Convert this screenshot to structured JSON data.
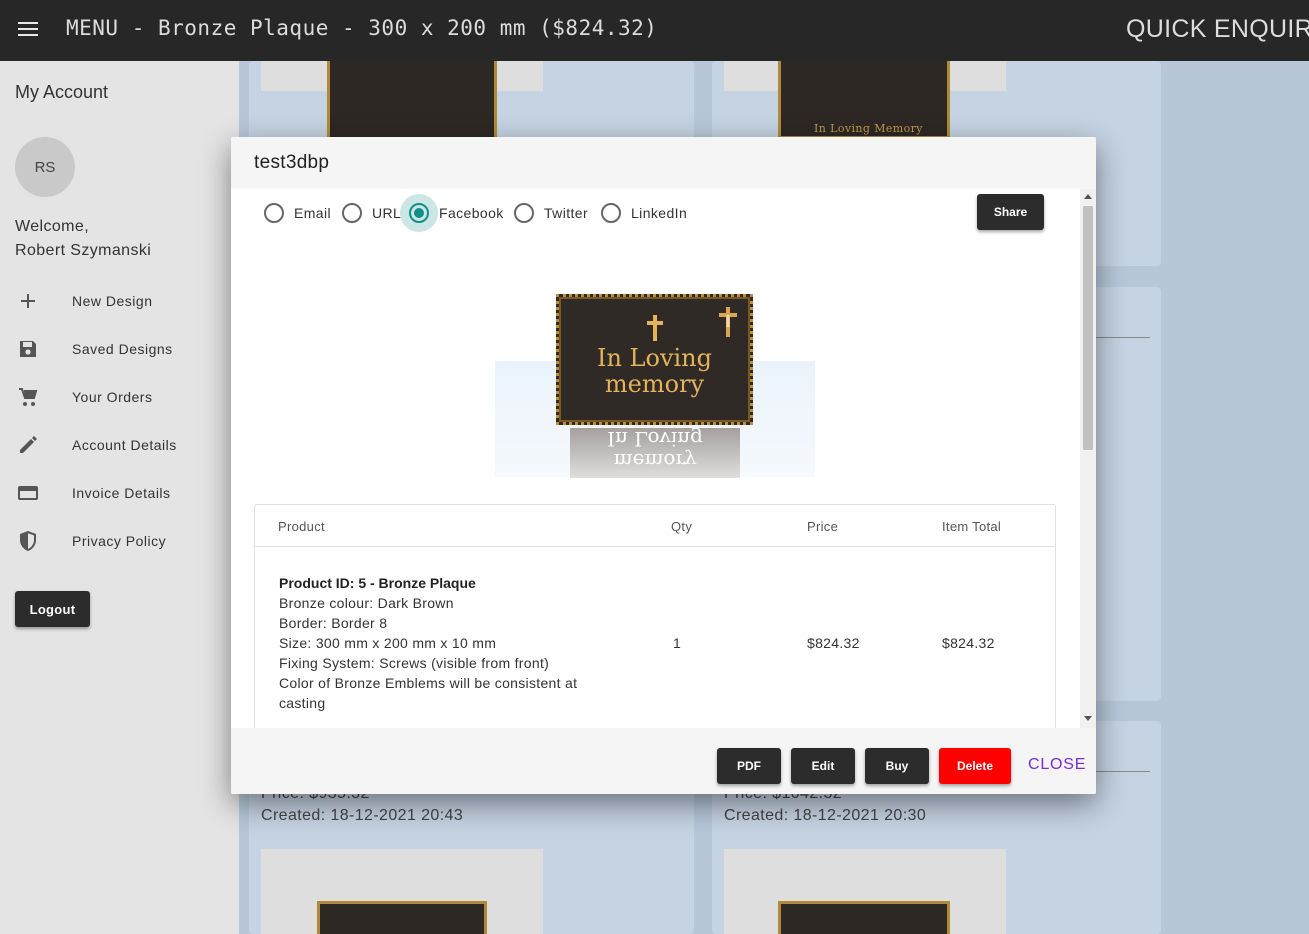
{
  "topbar": {
    "menu_title": "MENU - Bronze Plaque - 300 x 200 mm ($824.32)",
    "quick_enquiry": "QUICK ENQUIRY"
  },
  "sidebar": {
    "heading": "My Account",
    "avatar_initials": "RS",
    "welcome_line1": "Welcome,",
    "welcome_line2": "Robert Szymanski",
    "items": [
      {
        "label": "New Design",
        "icon": "plus-icon"
      },
      {
        "label": "Saved Designs",
        "icon": "save-icon"
      },
      {
        "label": "Your Orders",
        "icon": "cart-icon"
      },
      {
        "label": "Account Details",
        "icon": "pencil-icon"
      },
      {
        "label": "Invoice Details",
        "icon": "credit-card-icon"
      },
      {
        "label": "Privacy Policy",
        "icon": "shield-icon"
      }
    ],
    "logout_label": "Logout"
  },
  "background": {
    "card1_price": "Price: $935.32",
    "card1_created": "Created: 18-12-2021 20:43",
    "card2_price": "Price: $1042.32",
    "card2_created": "Created: 18-12-2021 20:30",
    "thumb_caption": "In Loving Memory"
  },
  "modal": {
    "title": "test3dbp",
    "share_options": [
      {
        "label": "Email",
        "selected": false
      },
      {
        "label": "URL",
        "selected": false
      },
      {
        "label": "Facebook",
        "selected": true
      },
      {
        "label": "Twitter",
        "selected": false
      },
      {
        "label": "LinkedIn",
        "selected": false
      }
    ],
    "share_button": "Share",
    "plaque_text_line1": "In Loving",
    "plaque_text_line2": "memory",
    "table": {
      "headers": {
        "product": "Product",
        "qty": "Qty",
        "price": "Price",
        "item_total": "Item Total"
      },
      "row": {
        "title": "Product ID: 5 - Bronze Plaque",
        "details": [
          "Bronze colour: Dark Brown",
          "Border: Border 8",
          "Size: 300 mm x 200 mm x 10 mm",
          "Fixing System: Screws (visible from front)",
          "Color of Bronze Emblems will be consistent at",
          "casting"
        ],
        "qty": "1",
        "price": "$824.32",
        "item_total": "$824.32"
      }
    },
    "footer": {
      "pdf": "PDF",
      "edit": "Edit",
      "buy": "Buy",
      "delete": "Delete",
      "close": "CLOSE"
    }
  },
  "colors": {
    "accent_radio": "#138f8a",
    "delete_red": "#ff0000",
    "close_purple": "#7b2bd0",
    "topbar": "#272727"
  }
}
